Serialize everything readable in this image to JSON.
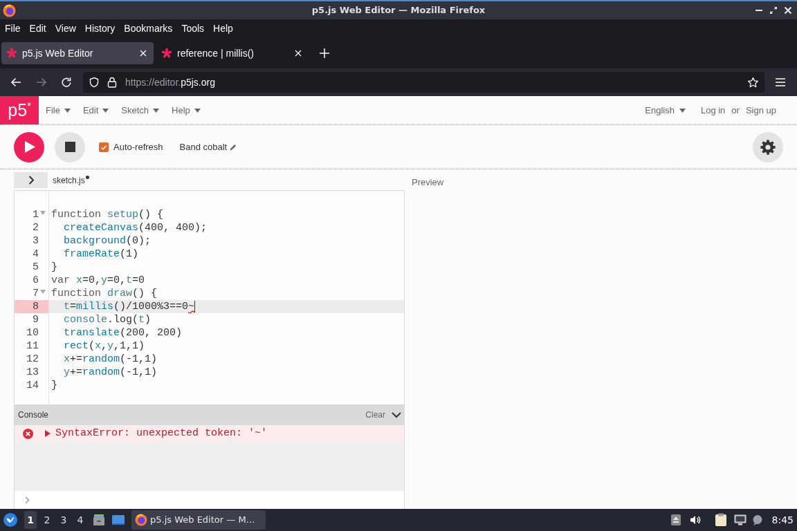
{
  "window": {
    "title": "p5.js Web Editor — Mozilla Firefox"
  },
  "menu_bar": [
    "File",
    "Edit",
    "View",
    "History",
    "Bookmarks",
    "Tools",
    "Help"
  ],
  "tabs": [
    {
      "label": "p5.js Web Editor",
      "selected": true
    },
    {
      "label": "reference | millis()",
      "selected": false
    }
  ],
  "navigation": {
    "forward_disabled": true,
    "url": {
      "prefix": "https://editor.",
      "domain": "p5js.org"
    }
  },
  "editor_header": {
    "logo": "p5$^{*}$",
    "menus": [
      "File",
      "Edit",
      "Sketch",
      "Help"
    ],
    "language": "English",
    "login": "Log in",
    "separator": "or",
    "signup": "Sign up"
  },
  "toolbar": {
    "auto_refresh": {
      "label": "Auto-refresh",
      "checked": true
    },
    "sketch_name": "Band cobalt"
  },
  "file_tab": {
    "name": "sketch.js",
    "unsaved": true
  },
  "preview": {
    "label": "Preview"
  },
  "code": {
    "lines": [
      {
        "number": "1",
        "foldable": true,
        "highlighted": false,
        "cursor": false,
        "tokens": [
          {
            "kind": "keyword",
            "text": "function "
          },
          {
            "kind": "def",
            "text": "setup"
          },
          {
            "kind": "plain",
            "text": "() {"
          }
        ],
        "children": [
          {
            "number": "2",
            "foldable": false,
            "highlighted": false,
            "cursor": false,
            "tokens": [
              {
                "kind": "builtin",
                "text": "createCanvas"
              },
              {
                "kind": "plain",
                "text": "(400, 400);"
              }
            ]
          },
          {
            "number": "3",
            "foldable": false,
            "highlighted": false,
            "cursor": false,
            "tokens": [
              {
                "kind": "builtin",
                "text": "background"
              },
              {
                "kind": "plain",
                "text": "(0);"
              }
            ]
          },
          {
            "number": "4",
            "foldable": false,
            "highlighted": false,
            "cursor": false,
            "tokens": [
              {
                "kind": "builtin",
                "text": "frameRate"
              },
              {
                "kind": "plain",
                "text": "(1)"
              }
            ]
          }
        ]
      },
      {
        "number": "5",
        "foldable": false,
        "highlighted": false,
        "cursor": false,
        "tokens": [
          {
            "kind": "plain",
            "text": "}"
          }
        ]
      },
      {
        "number": "6",
        "foldable": false,
        "highlighted": false,
        "cursor": false,
        "tokens": [
          {
            "kind": "keyword",
            "text": "var "
          },
          {
            "kind": "variable",
            "text": "x"
          },
          {
            "kind": "plain",
            "text": "=0,"
          },
          {
            "kind": "variable",
            "text": "y"
          },
          {
            "kind": "plain",
            "text": "=0,"
          },
          {
            "kind": "variable",
            "text": "t"
          },
          {
            "kind": "plain",
            "text": "=0"
          }
        ]
      },
      {
        "number": "7",
        "foldable": true,
        "highlighted": false,
        "cursor": false,
        "tokens": [
          {
            "kind": "keyword",
            "text": "function "
          },
          {
            "kind": "def",
            "text": "draw"
          },
          {
            "kind": "plain",
            "text": "() {"
          }
        ],
        "children": [
          {
            "number": "8",
            "foldable": false,
            "highlighted": true,
            "cursor": true,
            "tokens": [
              {
                "kind": "variable",
                "text": "t"
              },
              {
                "kind": "plain",
                "text": "="
              },
              {
                "kind": "builtin",
                "text": "millis"
              },
              {
                "kind": "plain",
                "text": "()/1000%3==0"
              },
              {
                "kind": "error",
                "text": "~"
              }
            ]
          },
          {
            "number": "9",
            "foldable": false,
            "highlighted": false,
            "cursor": false,
            "tokens": [
              {
                "kind": "variable",
                "text": "console"
              },
              {
                "kind": "plain",
                "text": ".log("
              },
              {
                "kind": "variable",
                "text": "t"
              },
              {
                "kind": "plain",
                "text": ")"
              }
            ]
          },
          {
            "number": "10",
            "foldable": false,
            "highlighted": false,
            "cursor": false,
            "tokens": [
              {
                "kind": "builtin",
                "text": "translate"
              },
              {
                "kind": "plain",
                "text": "(200, 200)"
              }
            ]
          },
          {
            "number": "11",
            "foldable": false,
            "highlighted": false,
            "cursor": false,
            "tokens": [
              {
                "kind": "builtin",
                "text": "rect"
              },
              {
                "kind": "plain",
                "text": "("
              },
              {
                "kind": "variable",
                "text": "x"
              },
              {
                "kind": "plain",
                "text": ","
              },
              {
                "kind": "variable",
                "text": "y"
              },
              {
                "kind": "plain",
                "text": ",1,1)"
              }
            ]
          },
          {
            "number": "12",
            "foldable": false,
            "highlighted": false,
            "cursor": false,
            "tokens": [
              {
                "kind": "variable",
                "text": "x"
              },
              {
                "kind": "plain",
                "text": "+="
              },
              {
                "kind": "builtin",
                "text": "random"
              },
              {
                "kind": "plain",
                "text": "(-1,1)"
              }
            ]
          },
          {
            "number": "13",
            "foldable": false,
            "highlighted": false,
            "cursor": false,
            "tokens": [
              {
                "kind": "variable",
                "text": "y"
              },
              {
                "kind": "plain",
                "text": "+="
              },
              {
                "kind": "builtin",
                "text": "random"
              },
              {
                "kind": "plain",
                "text": "(-1,1)"
              }
            ]
          }
        ]
      },
      {
        "number": "14",
        "foldable": false,
        "highlighted": false,
        "cursor": false,
        "tokens": [
          {
            "kind": "plain",
            "text": "}"
          }
        ]
      }
    ]
  },
  "console": {
    "title": "Console",
    "clear": "Clear",
    "messages": [
      {
        "kind": "error",
        "text": "SyntaxError: unexpected token: '~'"
      }
    ]
  },
  "taskbar": {
    "workspaces": [
      {
        "label": "1",
        "selected": true
      },
      {
        "label": "2",
        "selected": false
      },
      {
        "label": "3",
        "selected": false
      },
      {
        "label": "4",
        "selected": false
      }
    ],
    "task": "p5.js Web Editor — M…",
    "clock": "8:45"
  }
}
